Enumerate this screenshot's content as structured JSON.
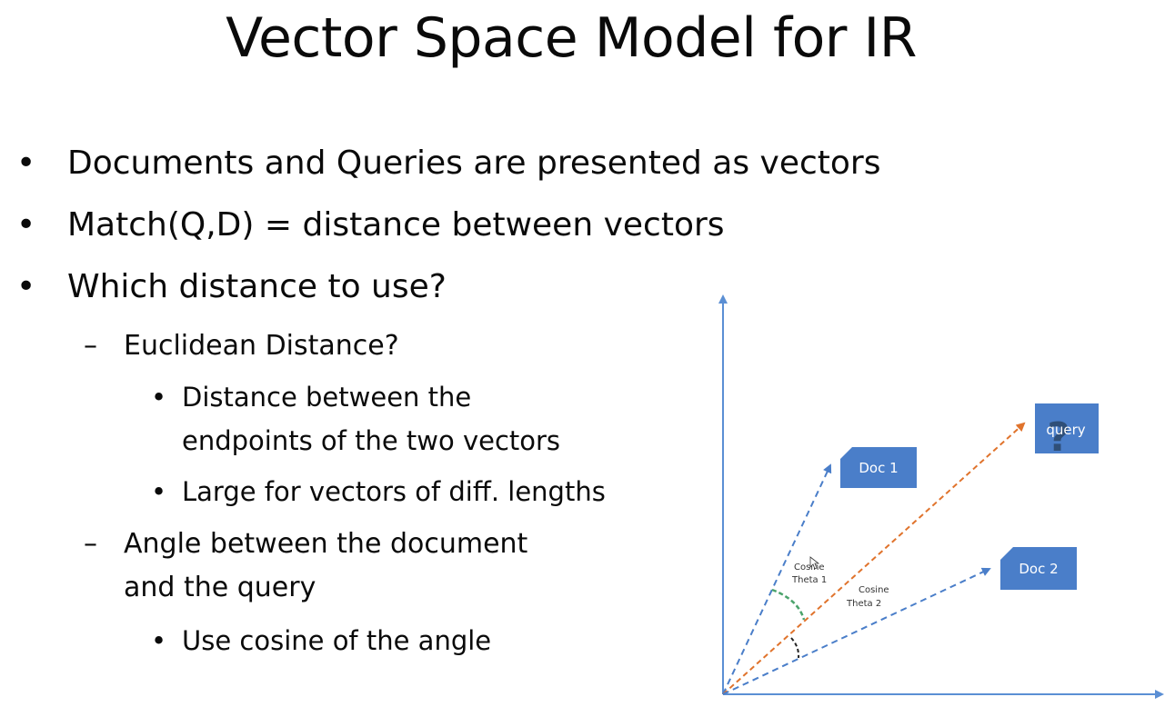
{
  "slide": {
    "title": "Vector Space Model for IR",
    "bullets": {
      "b1": "Documents and Queries are presented as vectors",
      "b2": "Match(Q,D) = distance between vectors",
      "b3": "Which distance to use?",
      "sub1": "Euclidean Distance?",
      "sub1a_line1": "Distance between the",
      "sub1a_line2": "endpoints of the two vectors",
      "sub1b": "Large for vectors of diff. lengths",
      "sub2_line1": "Angle between the document",
      "sub2_line2": "and the query",
      "sub2a": "Use cosine of the angle"
    },
    "markers": {
      "bullet": "•",
      "dash": "–"
    }
  },
  "diagram": {
    "doc1_label": "Doc 1",
    "doc2_label": "Doc 2",
    "query_label": "query",
    "query_mark": "?",
    "theta1_line1": "Cosine",
    "theta1_line2": "Theta 1",
    "theta2_line1": "Cosine",
    "theta2_line2": "Theta 2",
    "colors": {
      "axis": "#5b8fd4",
      "doc_vector": "#4a7ec9",
      "query_vector": "#e0732c",
      "box_fill": "#4a7ec9",
      "theta1_arc": "#4aa36b",
      "theta2_arc": "#222222"
    }
  }
}
